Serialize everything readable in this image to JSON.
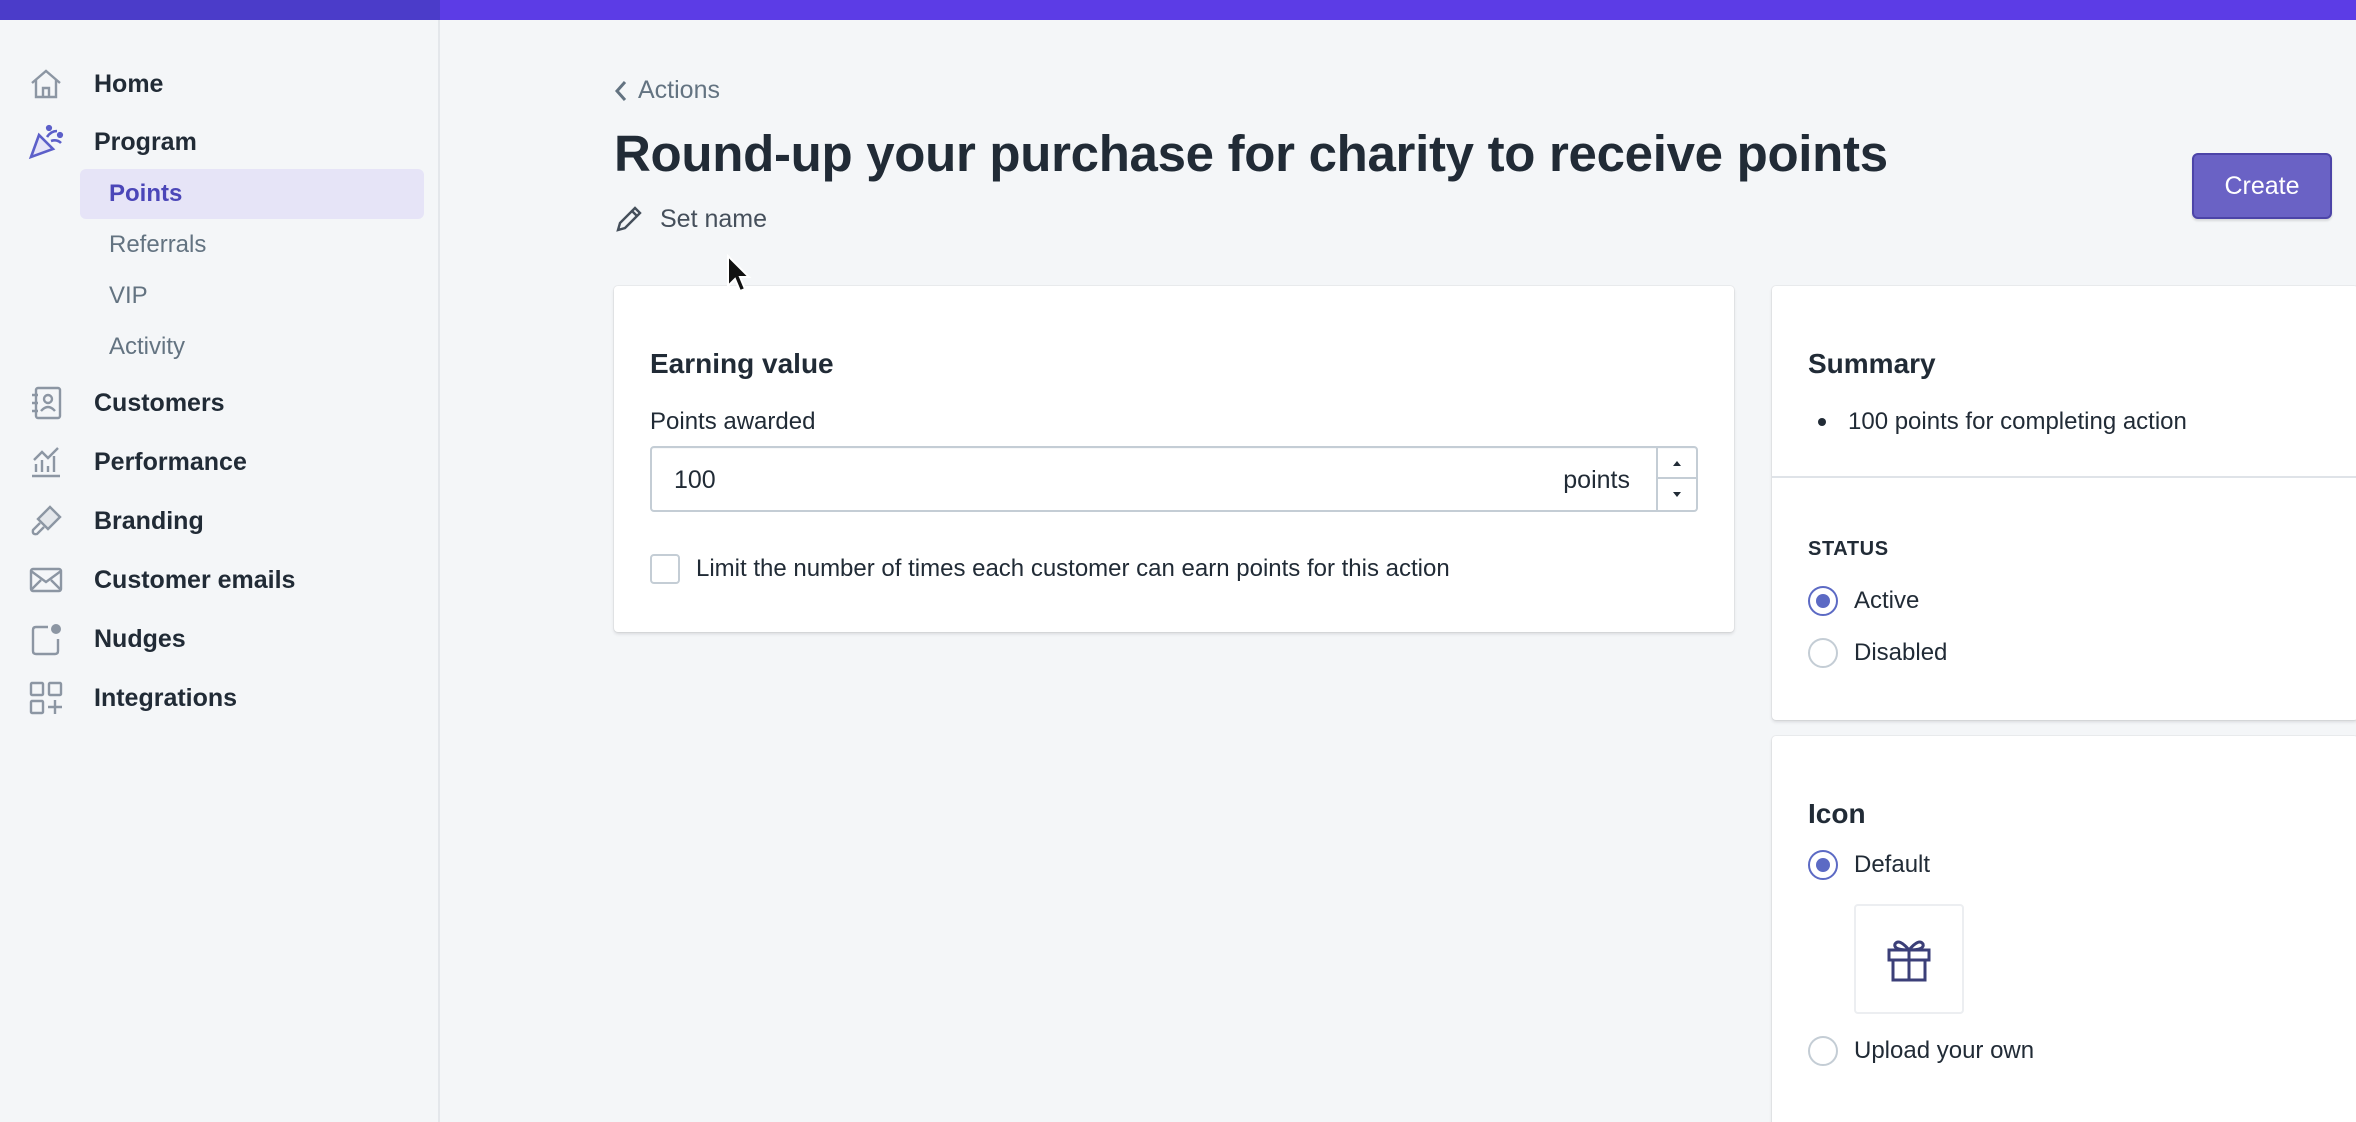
{
  "sidebar": {
    "items": [
      {
        "label": "Home",
        "icon": "home-icon"
      },
      {
        "label": "Program",
        "icon": "party-popper-icon"
      },
      {
        "label": "Customers",
        "icon": "contacts-icon"
      },
      {
        "label": "Performance",
        "icon": "chart-icon"
      },
      {
        "label": "Branding",
        "icon": "paint-brush-icon"
      },
      {
        "label": "Customer emails",
        "icon": "envelope-icon"
      },
      {
        "label": "Nudges",
        "icon": "notification-icon"
      },
      {
        "label": "Integrations",
        "icon": "apps-grid-icon"
      }
    ],
    "program_sub": [
      {
        "label": "Points",
        "active": true
      },
      {
        "label": "Referrals",
        "active": false
      },
      {
        "label": "VIP",
        "active": false
      },
      {
        "label": "Activity",
        "active": false
      }
    ]
  },
  "header": {
    "breadcrumb": "Actions",
    "title": "Round-up your purchase for charity to receive points",
    "set_name": "Set name",
    "create_label": "Create"
  },
  "earning": {
    "title": "Earning value",
    "points_label": "Points awarded",
    "points_value": "100",
    "points_suffix": "points",
    "limit_label": "Limit the number of times each customer can earn points for this action",
    "limit_checked": false
  },
  "summary": {
    "title": "Summary",
    "bullet": "100 points for completing action",
    "status_heading": "STATUS",
    "status_options": [
      {
        "label": "Active",
        "selected": true
      },
      {
        "label": "Disabled",
        "selected": false
      }
    ]
  },
  "icon_card": {
    "title": "Icon",
    "options": [
      {
        "label": "Default",
        "selected": true
      },
      {
        "label": "Upload your own",
        "selected": false
      }
    ],
    "preview_icon": "gift-icon"
  },
  "colors": {
    "accent": "#5c6ac4",
    "brand_bar": "#5c3ce6",
    "create_button": "#6a62c5"
  }
}
